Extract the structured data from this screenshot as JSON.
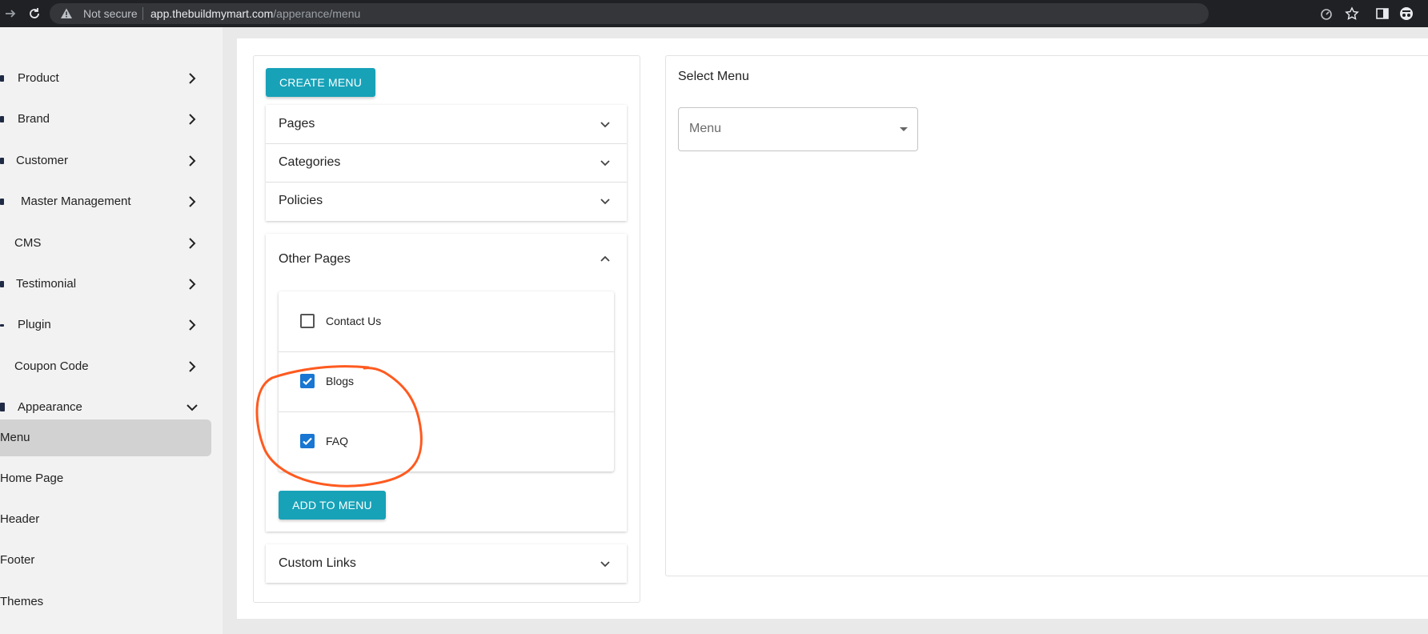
{
  "browser": {
    "security_label": "Not secure",
    "url_host": "app.thebuildmymart.com",
    "url_path": "/apperance/menu"
  },
  "sidebar": {
    "items": [
      {
        "label": "Product"
      },
      {
        "label": "Brand"
      },
      {
        "label": "Customer"
      },
      {
        "label": "Master Management"
      },
      {
        "label": "CMS"
      },
      {
        "label": "Testimonial"
      },
      {
        "label": "Plugin"
      },
      {
        "label": "Coupon Code"
      },
      {
        "label": "Appearance"
      }
    ],
    "sub_items": [
      {
        "label": "Menu",
        "active": true
      },
      {
        "label": "Home Page"
      },
      {
        "label": "Header"
      },
      {
        "label": "Footer"
      },
      {
        "label": "Themes"
      }
    ]
  },
  "left_panel": {
    "create_button": "CREATE MENU",
    "accordions": [
      {
        "title": "Pages",
        "expanded": false
      },
      {
        "title": "Categories",
        "expanded": false
      },
      {
        "title": "Policies",
        "expanded": false
      },
      {
        "title": "Other Pages",
        "expanded": true
      },
      {
        "title": "Custom Links",
        "expanded": false
      }
    ],
    "other_pages_options": [
      {
        "label": "Contact Us",
        "checked": false
      },
      {
        "label": "Blogs",
        "checked": true
      },
      {
        "label": "FAQ",
        "checked": true
      }
    ],
    "add_button": "ADD TO MENU"
  },
  "right_panel": {
    "title": "Select Menu",
    "select_placeholder": "Menu"
  },
  "annotation": {
    "color": "#ff5a1f",
    "shape": "hand-drawn circle around checked Blogs and FAQ"
  }
}
